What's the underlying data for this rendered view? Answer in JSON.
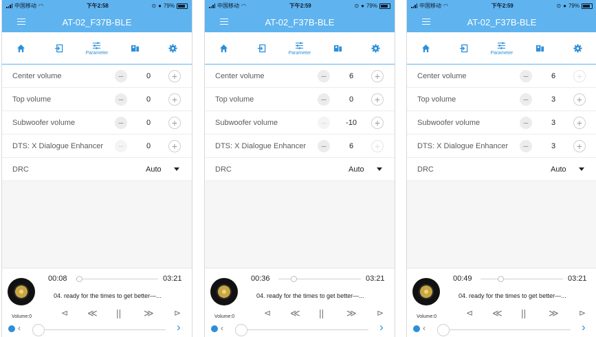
{
  "status": {
    "carrier": "中国移动",
    "battery": "79%"
  },
  "app_title": "AT-02_F37B-BLE",
  "tabs": [
    {
      "icon": "home-icon",
      "label": ""
    },
    {
      "icon": "input-icon",
      "label": ""
    },
    {
      "icon": "parameter-icon",
      "label": "Parameter"
    },
    {
      "icon": "speaker-layout-icon",
      "label": ""
    },
    {
      "icon": "gear-icon",
      "label": ""
    }
  ],
  "labels": {
    "center": "Center volume",
    "top": "Top volume",
    "subwoofer": "Subwoofer volume",
    "dts": "DTS: X Dialogue Enhancer",
    "drc": "DRC",
    "minus": "−",
    "plus": "+"
  },
  "screens": [
    {
      "time": "下午2:58",
      "center": "0",
      "top": "0",
      "subwoofer": "0",
      "dts": "0",
      "drc": "Auto",
      "elapsed": "00:08",
      "duration": "03:21",
      "progress": 0.04,
      "song": "04.  ready for the times to get better—...",
      "volume_label": "Volume:0"
    },
    {
      "time": "下午2:59",
      "center": "6",
      "top": "0",
      "subwoofer": "-10",
      "dts": "6",
      "drc": "Auto",
      "elapsed": "00:36",
      "duration": "03:21",
      "progress": 0.18,
      "song": "04.  ready for the times to get better—...",
      "volume_label": "Volume:0"
    },
    {
      "time": "下午2:59",
      "center": "6",
      "top": "3",
      "subwoofer": "3",
      "dts": "3",
      "drc": "Auto",
      "elapsed": "00:49",
      "duration": "03:21",
      "progress": 0.24,
      "song": "04.  ready for the times to get better—...",
      "volume_label": "Volume:0"
    }
  ],
  "colors": {
    "accent": "#5fb3ef",
    "icon_blue": "#2d8fd9"
  }
}
